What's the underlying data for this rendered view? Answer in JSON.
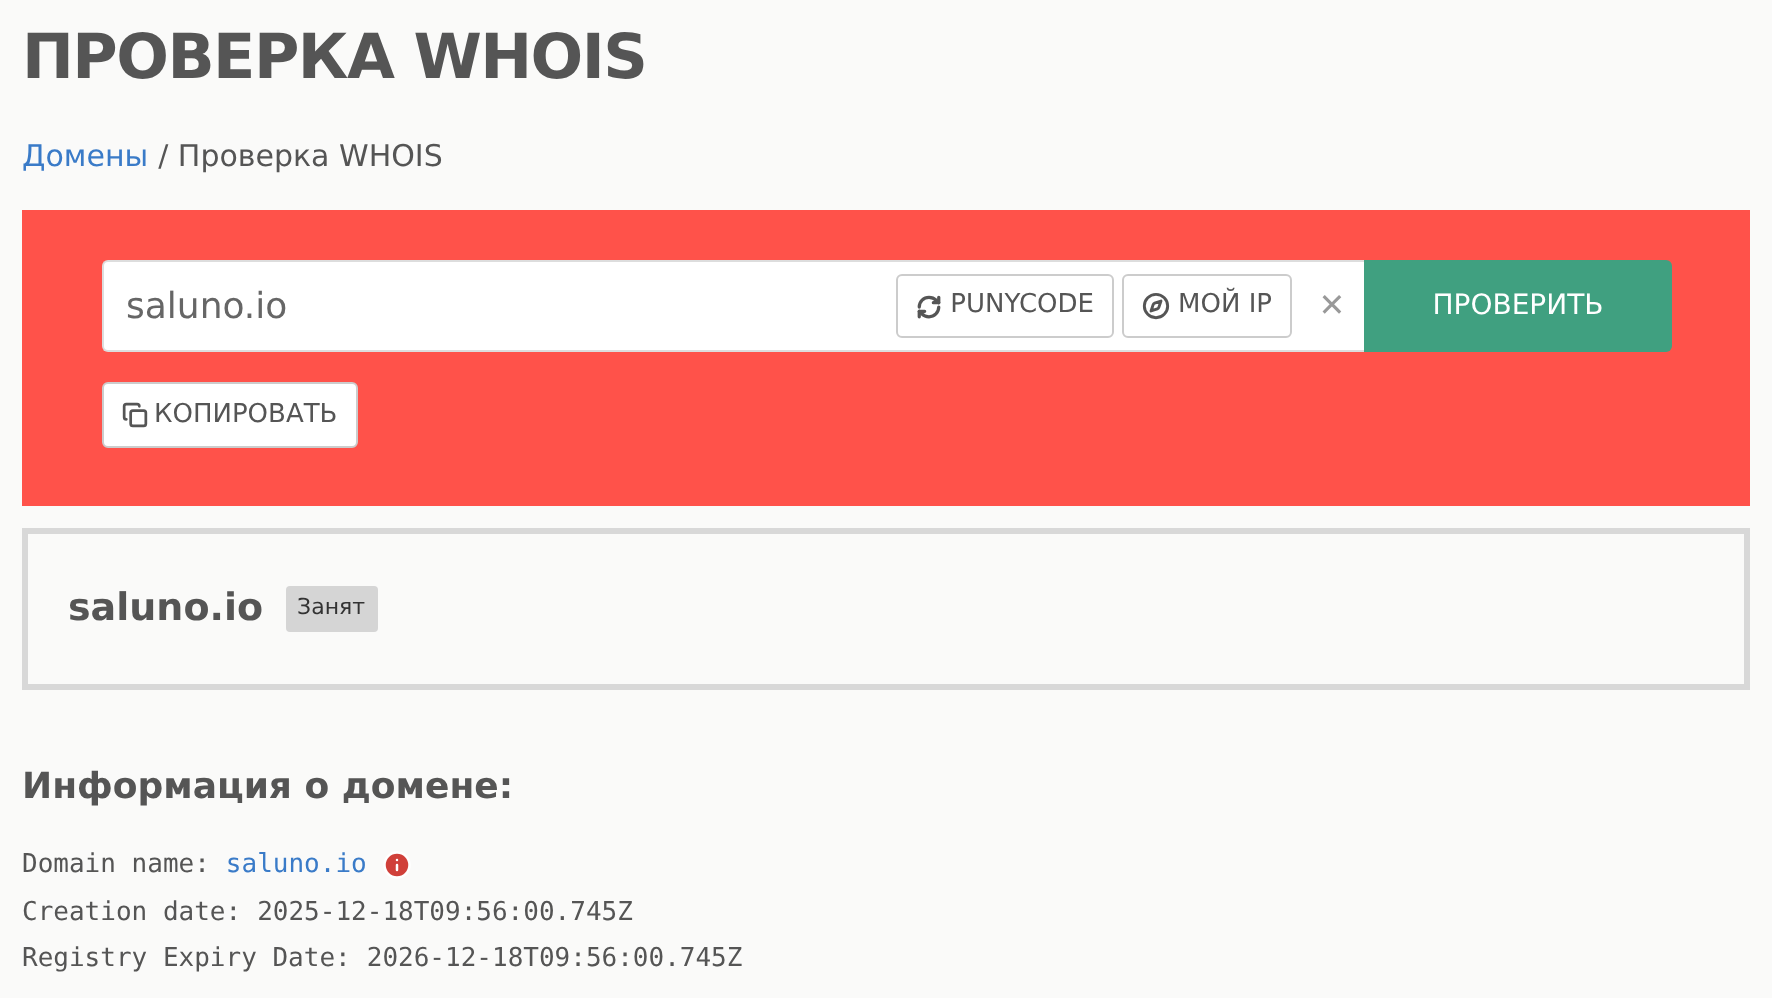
{
  "title": "ПРОВЕРКА WHOIS",
  "breadcrumb": [
    {
      "label": "Домены",
      "kind": "link"
    },
    {
      "label": "/ Проверка WHOIS",
      "kind": "current"
    }
  ],
  "search": {
    "value": "saluno.io",
    "buttons": [
      {
        "label": "PUNYCODE",
        "kind": "punycode"
      },
      {
        "label": "МОЙ IP",
        "kind": "myip"
      }
    ],
    "clear": "✕",
    "submit": "ПРОВЕРИТЬ"
  },
  "copy_button": "КОПИРОВАТЬ",
  "result": {
    "domain": "saluno.io",
    "status": "Занят"
  },
  "info": {
    "heading": "Информация о домене:",
    "lines": [
      {
        "label": "Domain name:",
        "value": "saluno.io",
        "kind": "link"
      },
      {
        "label": "Creation date:",
        "value": "2025-12-18T09:56:00.745Z",
        "kind": "text"
      },
      {
        "label": "Registry Expiry Date:",
        "value": "2026-12-18T09:56:00.745Z",
        "kind": "text"
      }
    ]
  }
}
